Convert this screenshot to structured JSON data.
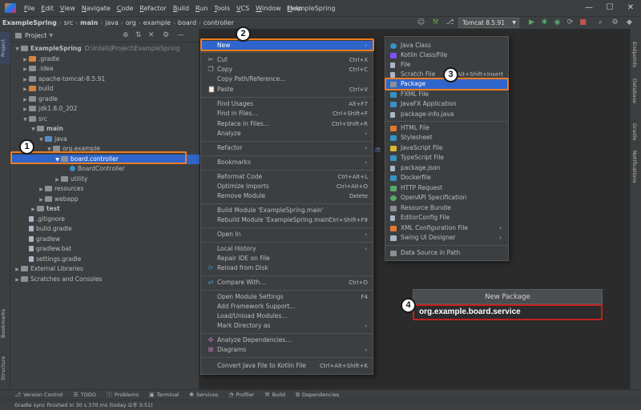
{
  "menubar": {
    "items": [
      "File",
      "Edit",
      "View",
      "Navigate",
      "Code",
      "Refactor",
      "Build",
      "Run",
      "Tools",
      "VCS",
      "Window",
      "Help"
    ],
    "window_title": "ExampleSpring"
  },
  "navbar": {
    "crumbs": [
      "ExampleSpring",
      "src",
      "main",
      "java",
      "org",
      "example",
      "board",
      "controller"
    ],
    "run_config": "Tomcat 8.5.91"
  },
  "left_strip": {
    "project": "Project",
    "bookmarks": "Bookmarks",
    "structure": "Structure"
  },
  "right_strip": {
    "endpoints": "Endpoints",
    "database": "Database",
    "gradle": "Gradle",
    "notifications": "Notifications"
  },
  "project_panel": {
    "title": "Project",
    "tree": [
      {
        "label": "ExampleSpring",
        "sub": "D:\\IntelliJProject\\ExampleSpring"
      },
      {
        "label": ".gradle"
      },
      {
        "label": ".idea"
      },
      {
        "label": "apache-tomcat-8.5.91"
      },
      {
        "label": "build"
      },
      {
        "label": "gradle"
      },
      {
        "label": "jdk1.8.0_202"
      },
      {
        "label": "src"
      },
      {
        "label": "main"
      },
      {
        "label": "java"
      },
      {
        "label": "org.example"
      },
      {
        "label": "board.controller"
      },
      {
        "label": "BoardController"
      },
      {
        "label": "utility"
      },
      {
        "label": "resources"
      },
      {
        "label": "webapp"
      },
      {
        "label": "test"
      },
      {
        "label": ".gitignore"
      },
      {
        "label": "build.gradle"
      },
      {
        "label": "gradlew"
      },
      {
        "label": "gradlew.bat"
      },
      {
        "label": "settings.gradle"
      },
      {
        "label": "External Libraries"
      },
      {
        "label": "Scratches and Consoles"
      }
    ]
  },
  "editor_fragment": "ift",
  "context_menu": {
    "items": [
      {
        "label": "New",
        "shortcut": ""
      },
      {
        "label": "Cut",
        "shortcut": "Ctrl+X"
      },
      {
        "label": "Copy",
        "shortcut": "Ctrl+C"
      },
      {
        "label": "Copy Path/Reference...",
        "shortcut": ""
      },
      {
        "label": "Paste",
        "shortcut": "Ctrl+V"
      },
      {
        "label": "Find Usages",
        "shortcut": "Alt+F7"
      },
      {
        "label": "Find in Files...",
        "shortcut": "Ctrl+Shift+F"
      },
      {
        "label": "Replace in Files...",
        "shortcut": "Ctrl+Shift+R"
      },
      {
        "label": "Analyze",
        "shortcut": ""
      },
      {
        "label": "Refactor",
        "shortcut": ""
      },
      {
        "label": "Bookmarks",
        "shortcut": ""
      },
      {
        "label": "Reformat Code",
        "shortcut": "Ctrl+Alt+L"
      },
      {
        "label": "Optimize Imports",
        "shortcut": "Ctrl+Alt+O"
      },
      {
        "label": "Remove Module",
        "shortcut": "Delete"
      },
      {
        "label": "Build Module 'ExampleSpring.main'",
        "shortcut": ""
      },
      {
        "label": "Rebuild Module 'ExampleSpring.main'",
        "shortcut": "Ctrl+Shift+F9"
      },
      {
        "label": "Open In",
        "shortcut": ""
      },
      {
        "label": "Local History",
        "shortcut": ""
      },
      {
        "label": "Repair IDE on File",
        "shortcut": ""
      },
      {
        "label": "Reload from Disk",
        "shortcut": ""
      },
      {
        "label": "Compare With...",
        "shortcut": "Ctrl+D"
      },
      {
        "label": "Open Module Settings",
        "shortcut": "F4"
      },
      {
        "label": "Add Framework Support...",
        "shortcut": ""
      },
      {
        "label": "Load/Unload Modules...",
        "shortcut": ""
      },
      {
        "label": "Mark Directory as",
        "shortcut": ""
      },
      {
        "label": "Analyze Dependencies...",
        "shortcut": ""
      },
      {
        "label": "Diagrams",
        "shortcut": ""
      },
      {
        "label": "Convert Java File to Kotlin File",
        "shortcut": "Ctrl+Alt+Shift+K"
      }
    ]
  },
  "new_submenu": {
    "items": [
      {
        "label": "Java Class",
        "shortcut": ""
      },
      {
        "label": "Kotlin Class/File",
        "shortcut": ""
      },
      {
        "label": "File",
        "shortcut": ""
      },
      {
        "label": "Scratch File",
        "shortcut": "Ctrl+Alt+Shift+Insert"
      },
      {
        "label": "Package",
        "shortcut": ""
      },
      {
        "label": "FXML File",
        "shortcut": ""
      },
      {
        "label": "JavaFX Application",
        "shortcut": ""
      },
      {
        "label": "package-info.java",
        "shortcut": ""
      },
      {
        "label": "HTML File",
        "shortcut": ""
      },
      {
        "label": "Stylesheet",
        "shortcut": ""
      },
      {
        "label": "JavaScript File",
        "shortcut": ""
      },
      {
        "label": "TypeScript File",
        "shortcut": ""
      },
      {
        "label": "package.json",
        "shortcut": ""
      },
      {
        "label": "Dockerfile",
        "shortcut": ""
      },
      {
        "label": "HTTP Request",
        "shortcut": ""
      },
      {
        "label": "OpenAPI Specification",
        "shortcut": ""
      },
      {
        "label": "Resource Bundle",
        "shortcut": ""
      },
      {
        "label": "EditorConfig File",
        "shortcut": ""
      },
      {
        "label": "XML Configuration File",
        "shortcut": ""
      },
      {
        "label": "Swing UI Designer",
        "shortcut": ""
      },
      {
        "label": "Data Source in Path",
        "shortcut": ""
      }
    ]
  },
  "new_package_dialog": {
    "title": "New Package",
    "value": "org.example.board.service"
  },
  "badges": [
    "1",
    "2",
    "3",
    "4"
  ],
  "bottom_tabs": [
    "Version Control",
    "TODO",
    "Problems",
    "Terminal",
    "Services",
    "Profiler",
    "Build",
    "Dependencies"
  ],
  "status": "Gradle sync finished in 30 s 370 ms (today 오후 3:51)",
  "colors": {
    "selection": "#2f65ca",
    "step_highlight": "#ef7d1f",
    "input_highlight": "#c3211f"
  }
}
